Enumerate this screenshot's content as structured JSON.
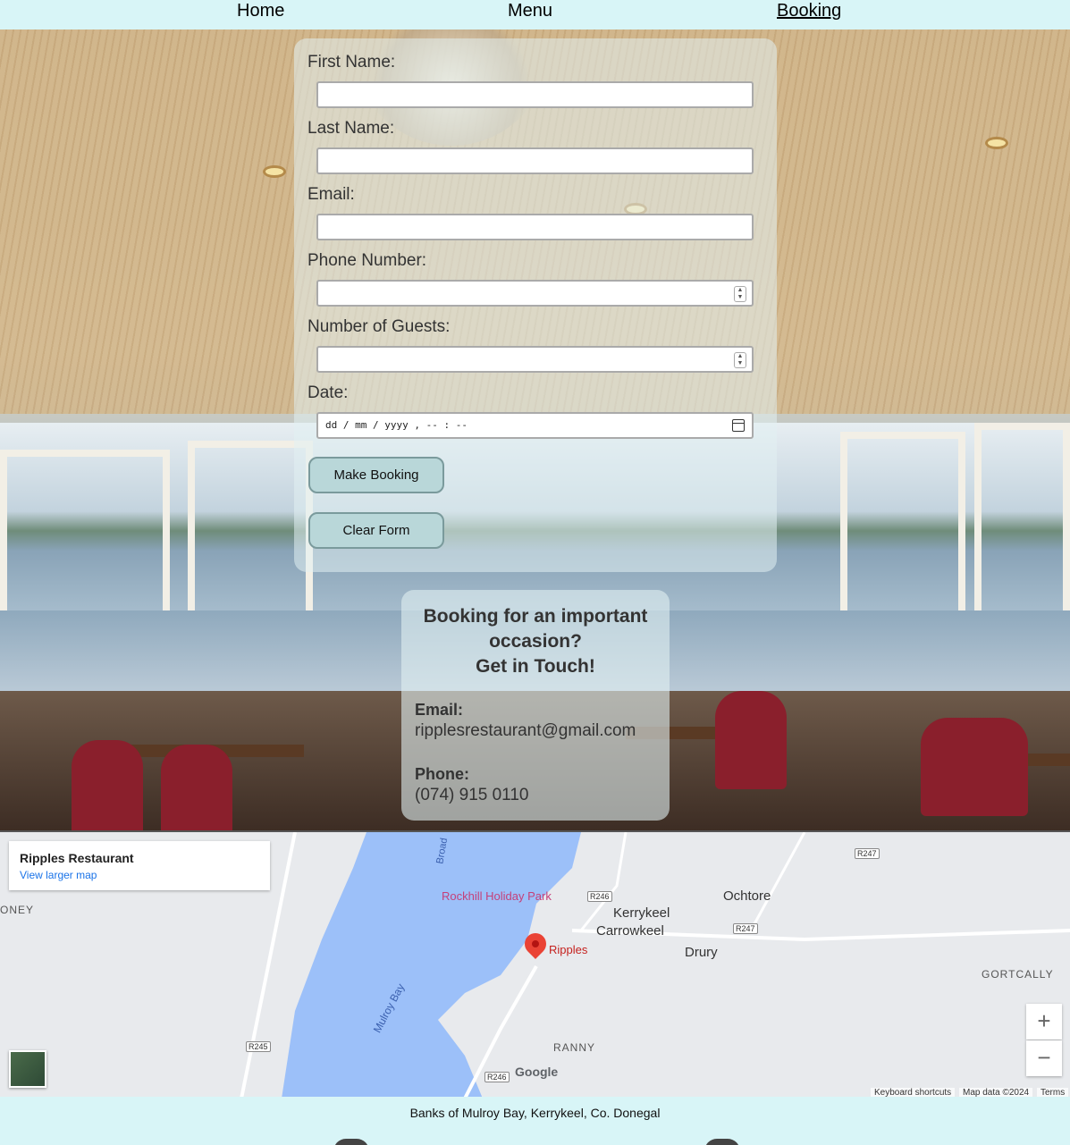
{
  "nav": {
    "home": "Home",
    "menu": "Menu",
    "booking": "Booking"
  },
  "form": {
    "first_name_label": "First Name:",
    "last_name_label": "Last Name:",
    "email_label": "Email:",
    "phone_label": "Phone Number:",
    "guests_label": "Number of Guests:",
    "date_label": "Date:",
    "date_placeholder": "dd / mm / yyyy ,  -- : --",
    "submit_label": "Make Booking",
    "clear_label": "Clear Form"
  },
  "contact": {
    "title_line1": "Booking for an important",
    "title_line2": "occasion?",
    "title_line3": "Get in Touch!",
    "email_label": "Email:",
    "email_value": "ripplesrestaurant@gmail.com",
    "phone_label": "Phone:",
    "phone_value": "(074) 915 0110"
  },
  "map": {
    "place_name": "Ripples Restaurant",
    "larger_map": "View larger map",
    "labels": {
      "rockhill": "Rockhill Holiday Park",
      "ochtore": "Ochtore",
      "kerrykeel": "Kerrykeel",
      "carrowkeel": "Carrowkeel",
      "drury": "Drury",
      "ripples": "Ripples",
      "gortcally": "GORTCALLY",
      "ranny": "RANNY",
      "oney": "ONEY",
      "mulroy_bay": "Mulroy Bay",
      "broad": "Broad"
    },
    "roads": [
      "R247",
      "R246",
      "R247",
      "R245",
      "R246"
    ],
    "zoom_in": "+",
    "zoom_out": "−",
    "keyboard": "Keyboard shortcuts",
    "map_data": "Map data ©2024",
    "terms": "Terms",
    "google": "Google"
  },
  "footer": {
    "address": "Banks of Mulroy Bay, Kerrykeel, Co. Donegal"
  }
}
